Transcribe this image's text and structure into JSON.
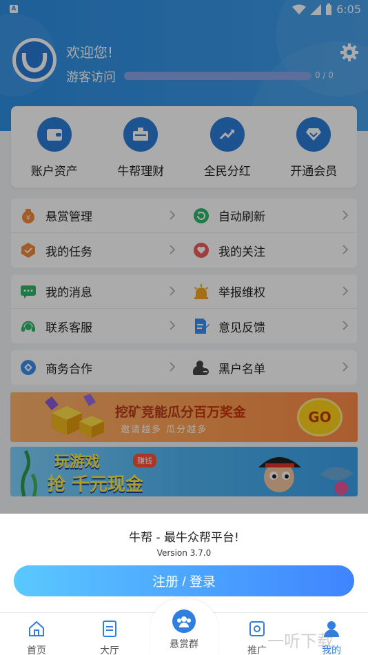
{
  "status_bar": {
    "time": "6:05",
    "app_badge": "A"
  },
  "profile": {
    "welcome": "欢迎您!",
    "visitor_label": "游客访问",
    "progress_text": "0 / 0",
    "progress_fraction": 0.0
  },
  "quick_actions": [
    {
      "label": "账户资产",
      "icon": "wallet-icon"
    },
    {
      "label": "牛帮理财",
      "icon": "finance-icon"
    },
    {
      "label": "全民分红",
      "icon": "trend-up-icon"
    },
    {
      "label": "开通会员",
      "icon": "diamond-icon"
    }
  ],
  "menu_groups": [
    {
      "rows": [
        [
          {
            "label": "悬赏管理",
            "icon": "money-bag-icon",
            "color": "#f08a3c"
          },
          {
            "label": "自动刷新",
            "icon": "refresh-icon",
            "color": "#2eb86b"
          }
        ],
        [
          {
            "label": "我的任务",
            "icon": "task-icon",
            "color": "#f08a3c"
          },
          {
            "label": "我的关注",
            "icon": "heart-icon",
            "color": "#ef5d5d"
          }
        ]
      ]
    },
    {
      "rows": [
        [
          {
            "label": "我的消息",
            "icon": "message-icon",
            "color": "#2eb86b"
          },
          {
            "label": "举报维权",
            "icon": "alarm-icon",
            "color": "#f5a623"
          }
        ],
        [
          {
            "label": "联系客服",
            "icon": "headset-icon",
            "color": "#2eb86b"
          },
          {
            "label": "意见反馈",
            "icon": "feedback-icon",
            "color": "#3d8ef0"
          }
        ]
      ]
    },
    {
      "rows": [
        [
          {
            "label": "商务合作",
            "icon": "business-icon",
            "color": "#3d8ef0"
          },
          {
            "label": "黑户名单",
            "icon": "blacklist-icon",
            "color": "#444444"
          }
        ]
      ]
    }
  ],
  "banners": {
    "mining": {
      "title_a": "挖矿竞能瓜分",
      "title_b": "百万奖金",
      "subtitle": "邀请越多  瓜分越多",
      "cta": "GO"
    },
    "game": {
      "line1": "玩游戏",
      "badge": "赚钱",
      "line2": "抢 千元现金"
    }
  },
  "sheet": {
    "title": "牛帮 - 最牛众帮平台!",
    "version": "Version 3.7.0",
    "login_label": "注册 / 登录"
  },
  "tabs": [
    {
      "label": "首页",
      "icon": "home-icon"
    },
    {
      "label": "大厅",
      "icon": "hall-icon"
    },
    {
      "label": "悬赏群",
      "icon": "group-icon"
    },
    {
      "label": "推广",
      "icon": "promote-icon"
    },
    {
      "label": "我的",
      "icon": "me-icon"
    }
  ],
  "watermark": "一听下载",
  "colors": {
    "primary": "#2f8fe4",
    "accent": "#2e7fe0",
    "active_tab": "#2f7ee0"
  }
}
